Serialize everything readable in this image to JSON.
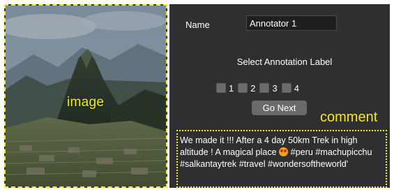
{
  "image_panel": {
    "label": "image",
    "label_color": "#f4e81c",
    "frame_color": "#f2ea2b"
  },
  "form": {
    "name_label": "Name",
    "name_value": "Annotator 1",
    "select_title": "Select Annotation Label",
    "options": [
      {
        "label": "1",
        "checked": false
      },
      {
        "label": "2",
        "checked": false
      },
      {
        "label": "3",
        "checked": false
      },
      {
        "label": "4",
        "checked": false
      }
    ],
    "go_button": "Go Next"
  },
  "comment": {
    "heading": "comment",
    "text_before_emoji": "We made it !!! After a 4 day 50km Trek in high altitude ! A magical place",
    "emoji_icon": "heart-eyes-emoji-icon",
    "text_after_emoji": " #peru #machupicchu #salkantaytrek #travel #wondersoftheworld'"
  },
  "colors": {
    "panel_bg": "#2f2f31",
    "accent_yellow": "#f4e81c"
  }
}
